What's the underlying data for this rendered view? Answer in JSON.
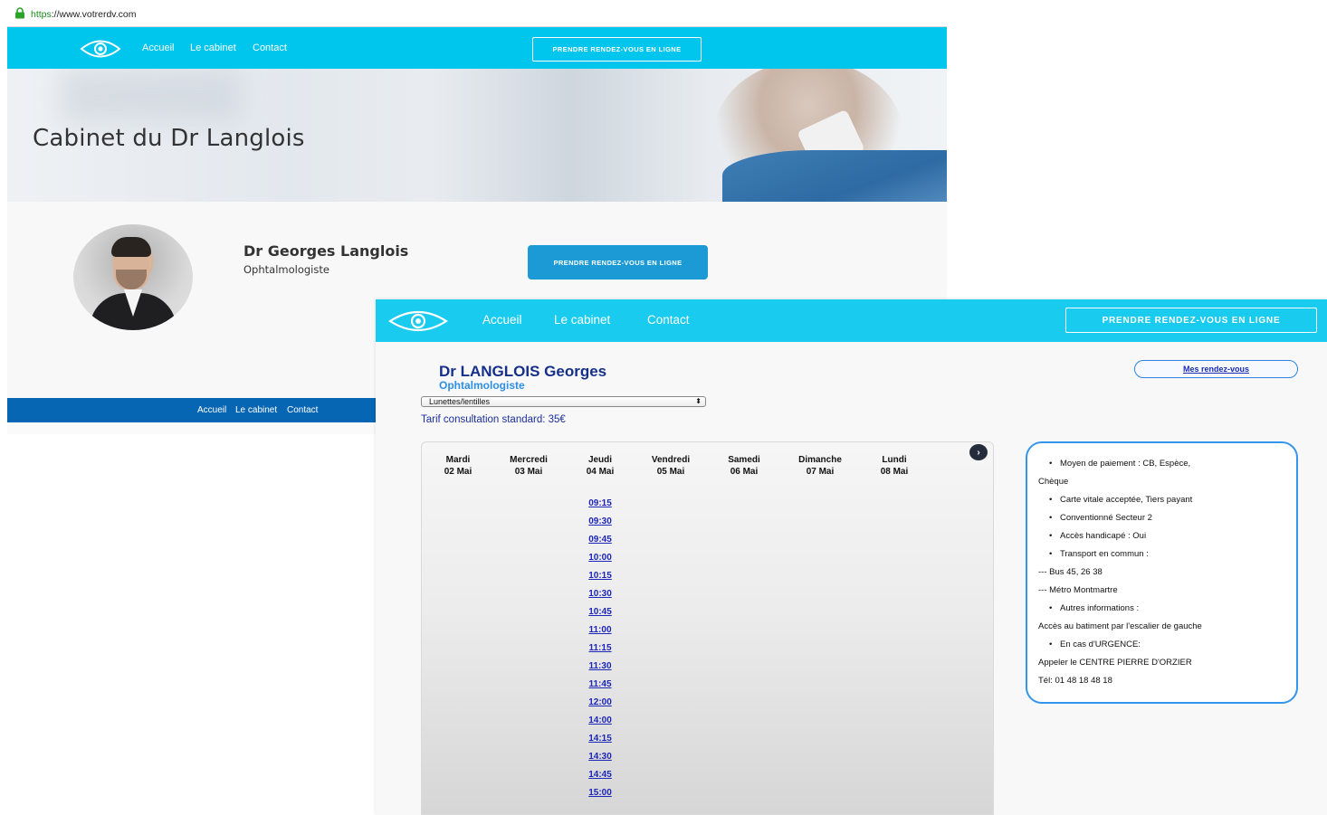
{
  "browser": {
    "url_scheme": "https",
    "url_rest": "://www.votrerdv.com"
  },
  "site": {
    "nav": {
      "home": "Accueil",
      "cabinet": "Le cabinet",
      "contact": "Contact",
      "cta": "PRENDRE RENDEZ-VOUS EN LIGNE"
    },
    "hero_title": "Cabinet du Dr Langlois",
    "doctor_name": "Dr Georges Langlois",
    "doctor_specialty": "Ophtalmologiste",
    "profile_cta": "PRENDRE RENDEZ-VOUS EN LIGNE",
    "footer": {
      "home": "Accueil",
      "cabinet": "Le cabinet",
      "contact": "Contact"
    }
  },
  "booking": {
    "nav": {
      "home": "Accueil",
      "cabinet": "Le cabinet",
      "contact": "Contact",
      "cta": "PRENDRE RENDEZ-VOUS EN LIGNE"
    },
    "doctor_name": "Dr LANGLOIS Georges",
    "doctor_specialty": "Ophtalmologiste",
    "motif_selected": "Lunettes/lentilles",
    "tarif": "Tarif consultation standard: 35€",
    "my_appointments": "Mes rendez-vous",
    "next_icon": "chevron-right-icon",
    "days": [
      {
        "name": "Mardi",
        "date": "02 Mai"
      },
      {
        "name": "Mercredi",
        "date": "03 Mai"
      },
      {
        "name": "Jeudi",
        "date": "04 Mai"
      },
      {
        "name": "Vendredi",
        "date": "05 Mai"
      },
      {
        "name": "Samedi",
        "date": "06 Mai"
      },
      {
        "name": "Dimanche",
        "date": "07 Mai"
      },
      {
        "name": "Lundi",
        "date": "08 Mai"
      }
    ],
    "slots_day": "Jeudi 04 Mai",
    "slots": [
      "09:15",
      "09:30",
      "09:45",
      "10:00",
      "10:15",
      "10:30",
      "10:45",
      "11:00",
      "11:15",
      "11:30",
      "11:45",
      "12:00",
      "14:00",
      "14:15",
      "14:30",
      "14:45",
      "15:00"
    ],
    "info": [
      {
        "text": "Moyen de paiement : CB, Espèce,",
        "bullet": true
      },
      {
        "text": "Chèque",
        "bullet": false
      },
      {
        "text": "Carte vitale acceptée, Tiers payant",
        "bullet": true
      },
      {
        "text": "Conventionné Secteur 2",
        "bullet": true
      },
      {
        "text": "Accès handicapé : Oui",
        "bullet": true
      },
      {
        "text": "Transport en commun :",
        "bullet": true
      },
      {
        "text": "--- Bus 45, 26 38",
        "bullet": false
      },
      {
        "text": "--- Métro Montmartre",
        "bullet": false
      },
      {
        "text": "Autres informations :",
        "bullet": true
      },
      {
        "text": "Accès au batiment par l'escalier de gauche",
        "bullet": false
      },
      {
        "text": "En cas d'URGENCE:",
        "bullet": true
      },
      {
        "text": "Appeler le CENTRE PIERRE D'ORZIER",
        "bullet": false
      },
      {
        "text": "Tél: 01 48 18 48 18",
        "bullet": false
      }
    ]
  },
  "colors": {
    "nav_cyan": "#00c5ec",
    "booking_nav_cyan": "#19cbee",
    "footer_blue": "#0766b4",
    "cta_blue": "#1b9ad6",
    "doctor_navy": "#16308a",
    "slot_link": "#1b25b8",
    "info_border": "#3395ee"
  }
}
